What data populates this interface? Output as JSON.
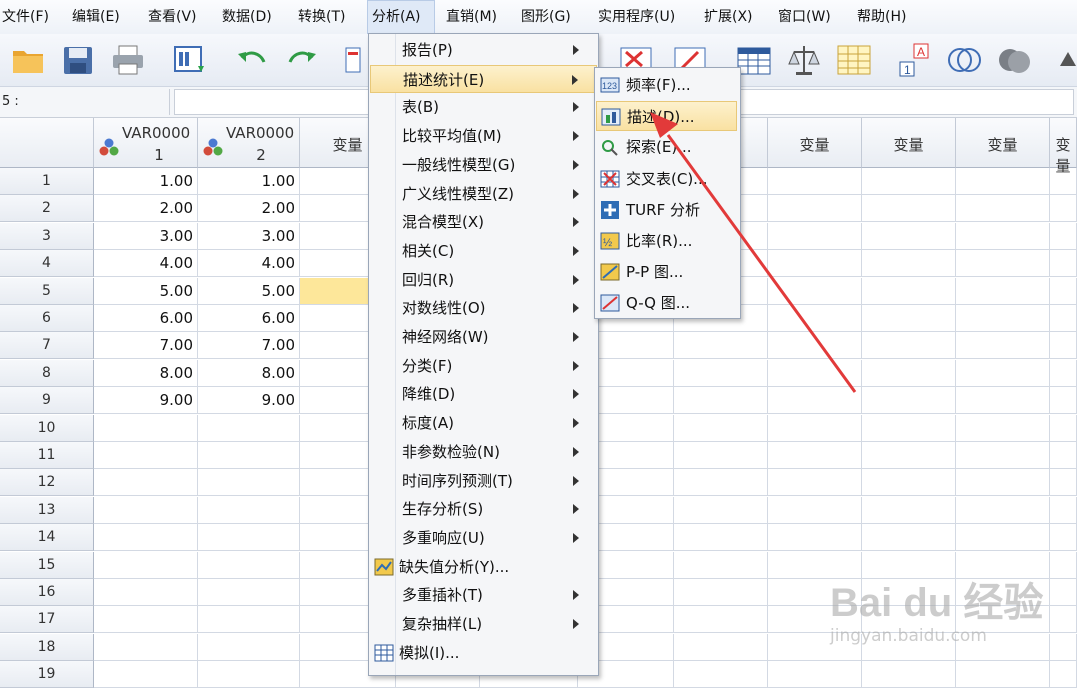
{
  "menubar": {
    "items": [
      {
        "label": "文件(F)"
      },
      {
        "label": "编辑(E)"
      },
      {
        "label": "查看(V)"
      },
      {
        "label": "数据(D)"
      },
      {
        "label": "转换(T)"
      },
      {
        "label": "分析(A)"
      },
      {
        "label": "直销(M)"
      },
      {
        "label": "图形(G)"
      },
      {
        "label": "实用程序(U)"
      },
      {
        "label": "扩展(X)"
      },
      {
        "label": "窗口(W)"
      },
      {
        "label": "帮助(H)"
      }
    ]
  },
  "editbar": {
    "cell_ref": "5 :"
  },
  "grid": {
    "columns": [
      {
        "label_top": "VAR0000",
        "label_bottom": "1",
        "has_icon": true
      },
      {
        "label_top": "VAR0000",
        "label_bottom": "2",
        "has_icon": true
      },
      {
        "label_top": "变量"
      },
      {
        "label_top": "变量"
      },
      {
        "label_top": "变量"
      },
      {
        "label_top": "变量"
      },
      {
        "label_top": "变量"
      },
      {
        "label_top": "变量"
      },
      {
        "label_top": "变量"
      }
    ],
    "row_numbers": [
      "1",
      "2",
      "3",
      "4",
      "5",
      "6",
      "7",
      "8",
      "9",
      "10",
      "11",
      "12",
      "13",
      "14",
      "15",
      "16",
      "17",
      "18",
      "19"
    ],
    "var1": [
      "1.00",
      "2.00",
      "3.00",
      "4.00",
      "5.00",
      "6.00",
      "7.00",
      "8.00",
      "9.00"
    ],
    "var2": [
      "1.00",
      "2.00",
      "3.00",
      "4.00",
      "5.00",
      "6.00",
      "7.00",
      "8.00",
      "9.00"
    ]
  },
  "analyze_menu": {
    "items": [
      {
        "label": "报告(P)",
        "submenu": true
      },
      {
        "label": "描述统计(E)",
        "submenu": true,
        "highlighted": true
      },
      {
        "label": "表(B)",
        "submenu": true
      },
      {
        "label": "比较平均值(M)",
        "submenu": true
      },
      {
        "label": "一般线性模型(G)",
        "submenu": true
      },
      {
        "label": "广义线性模型(Z)",
        "submenu": true
      },
      {
        "label": "混合模型(X)",
        "submenu": true
      },
      {
        "label": "相关(C)",
        "submenu": true
      },
      {
        "label": "回归(R)",
        "submenu": true
      },
      {
        "label": "对数线性(O)",
        "submenu": true
      },
      {
        "label": "神经网络(W)",
        "submenu": true
      },
      {
        "label": "分类(F)",
        "submenu": true
      },
      {
        "label": "降维(D)",
        "submenu": true
      },
      {
        "label": "标度(A)",
        "submenu": true
      },
      {
        "label": "非参数检验(N)",
        "submenu": true
      },
      {
        "label": "时间序列预测(T)",
        "submenu": true
      },
      {
        "label": "生存分析(S)",
        "submenu": true
      },
      {
        "label": "多重响应(U)",
        "submenu": true
      },
      {
        "label": "缺失值分析(Y)...",
        "icon": "missing-value-icon"
      },
      {
        "label": "多重插补(T)",
        "submenu": true
      },
      {
        "label": "复杂抽样(L)",
        "submenu": true
      },
      {
        "label": "模拟(I)...",
        "icon": "simulation-icon"
      }
    ]
  },
  "descriptive_submenu": {
    "items": [
      {
        "label": "频率(F)...",
        "icon": "frequencies-icon"
      },
      {
        "label": "描述(D)...",
        "icon": "descriptives-icon",
        "highlighted": true
      },
      {
        "label": "探索(E)...",
        "icon": "explore-icon"
      },
      {
        "label": "交叉表(C)...",
        "icon": "crosstabs-icon"
      },
      {
        "label": "TURF 分析",
        "icon": "turf-icon"
      },
      {
        "label": "比率(R)...",
        "icon": "ratio-icon"
      },
      {
        "label": "P-P 图...",
        "icon": "pp-plot-icon"
      },
      {
        "label": "Q-Q 图...",
        "icon": "qq-plot-icon"
      }
    ]
  },
  "watermark": {
    "brand": "Bai du 经验",
    "url": "jingyan.baidu.com"
  },
  "colors": {
    "arrow": "#e23a3a",
    "highlight": "#f9e1a2",
    "selected_cell": "#fde79a"
  }
}
